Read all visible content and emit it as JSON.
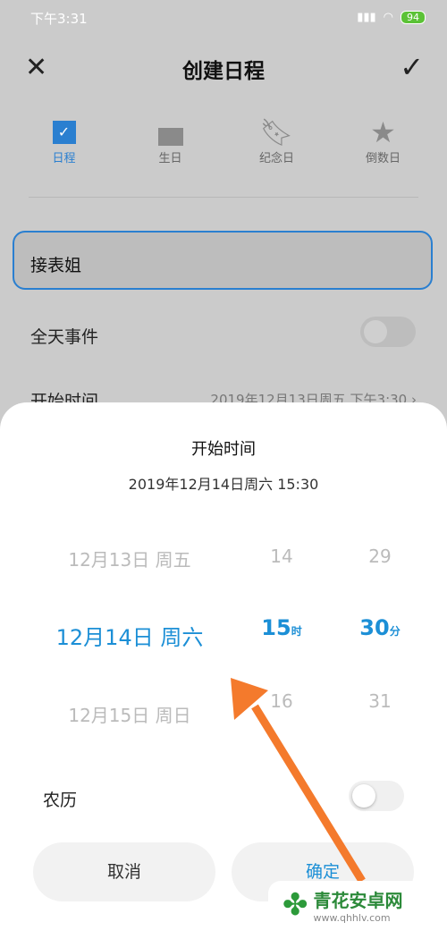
{
  "status": {
    "time": "下午3:31",
    "battery": "94"
  },
  "header": {
    "title": "创建日程"
  },
  "tabs": [
    {
      "label": "日程",
      "icon": "checkbox-icon"
    },
    {
      "label": "生日",
      "icon": "cake-icon"
    },
    {
      "label": "纪念日",
      "icon": "bookmark-icon"
    },
    {
      "label": "倒数日",
      "icon": "star-icon"
    }
  ],
  "form": {
    "title_value": "接表姐",
    "all_day": "全天事件",
    "start_label": "开始时间",
    "start_value": "2019年12月13日周五 下午3:30"
  },
  "sheet": {
    "title": "开始时间",
    "subtitle": "2019年12月14日周六 15:30",
    "dates": [
      "12月13日 周五",
      "12月14日 周六",
      "12月15日 周日"
    ],
    "hours": [
      "14",
      "15",
      "16"
    ],
    "hour_unit": "时",
    "minutes": [
      "29",
      "30",
      "31"
    ],
    "minute_unit": "分",
    "lunar": "农历",
    "cancel": "取消",
    "confirm": "确定"
  },
  "watermark": {
    "name": "青花安卓网",
    "url": "www.qhhlv.com"
  },
  "colors": {
    "accent": "#1c8fd6",
    "arrow": "#f47a2c"
  }
}
